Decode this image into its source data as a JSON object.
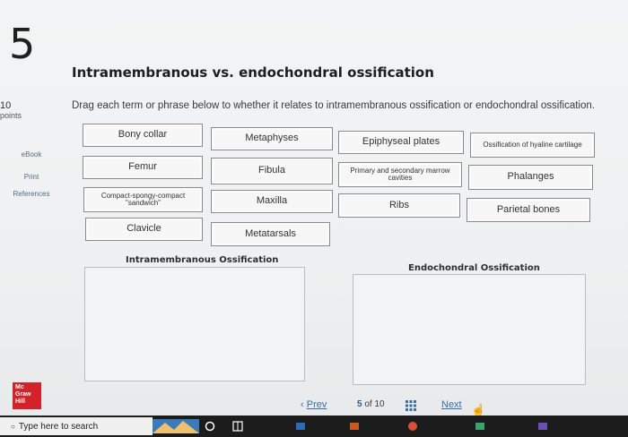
{
  "question": {
    "number": "5",
    "title": "Intramembranous vs. endochondral ossification"
  },
  "points": {
    "value": "10",
    "label": "points"
  },
  "sidebar": {
    "items": [
      "eBook",
      "Print",
      "References"
    ]
  },
  "instructions": "Drag each term or phrase below to whether it relates to intramembranous ossification or endochondral ossification.",
  "terms": [
    "Bony collar",
    "Metaphyses",
    "Epiphyseal plates",
    "Ossification of hyaline cartilage",
    "Femur",
    "Fibula",
    "Primary and secondary marrow cavities",
    "Phalanges",
    "Compact-spongy-compact \"sandwich\"",
    "Maxilla",
    "Ribs",
    "Parietal bones",
    "Clavicle",
    "Metatarsals"
  ],
  "zones": {
    "intramembranous": "Intramembranous Ossification",
    "endochondral": "Endochondral Ossification"
  },
  "logo": {
    "line1": "Mc",
    "line2": "Graw",
    "line3": "Hill"
  },
  "nav": {
    "prev": "Prev",
    "page_current": "5",
    "page_sep": "of",
    "page_total": "10",
    "next": "Next"
  },
  "taskbar": {
    "search_placeholder": "Type here to search"
  }
}
